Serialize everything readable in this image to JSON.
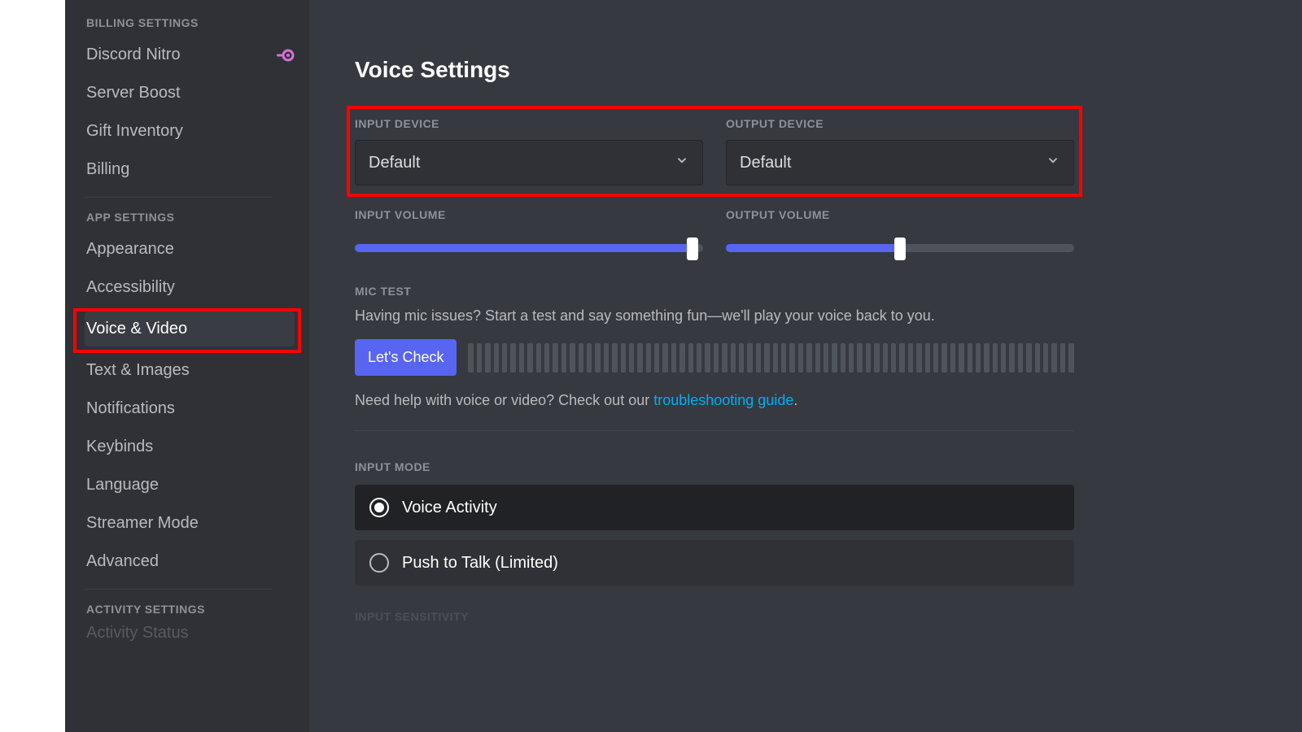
{
  "sidebar": {
    "billing_header": "BILLING SETTINGS",
    "items_billing": [
      {
        "label": "Discord Nitro",
        "nitro": true
      },
      {
        "label": "Server Boost"
      },
      {
        "label": "Gift Inventory"
      },
      {
        "label": "Billing"
      }
    ],
    "app_header": "APP SETTINGS",
    "items_app": [
      {
        "label": "Appearance"
      },
      {
        "label": "Accessibility"
      },
      {
        "label": "Voice & Video",
        "active": true
      },
      {
        "label": "Text & Images"
      },
      {
        "label": "Notifications"
      },
      {
        "label": "Keybinds"
      },
      {
        "label": "Language"
      },
      {
        "label": "Streamer Mode"
      },
      {
        "label": "Advanced"
      }
    ],
    "activity_header": "ACTIVITY SETTINGS",
    "activity_cutoff": "Activity Status"
  },
  "main": {
    "title": "Voice Settings",
    "input_device_label": "INPUT DEVICE",
    "input_device_value": "Default",
    "output_device_label": "OUTPUT DEVICE",
    "output_device_value": "Default",
    "input_volume_label": "INPUT VOLUME",
    "input_volume_percent": 97,
    "output_volume_label": "OUTPUT VOLUME",
    "output_volume_percent": 50,
    "mic_test_label": "MIC TEST",
    "mic_test_desc": "Having mic issues? Start a test and say something fun—we'll play your voice back to you.",
    "lets_check": "Let's Check",
    "help_pre": "Need help with voice or video? Check out our ",
    "help_link": "troubleshooting guide",
    "help_post": ".",
    "input_mode_label": "INPUT MODE",
    "input_mode_options": [
      {
        "label": "Voice Activity",
        "selected": true
      },
      {
        "label": "Push to Talk (Limited)",
        "selected": false
      }
    ],
    "sensitivity_cutoff": "INPUT SENSITIVITY"
  }
}
